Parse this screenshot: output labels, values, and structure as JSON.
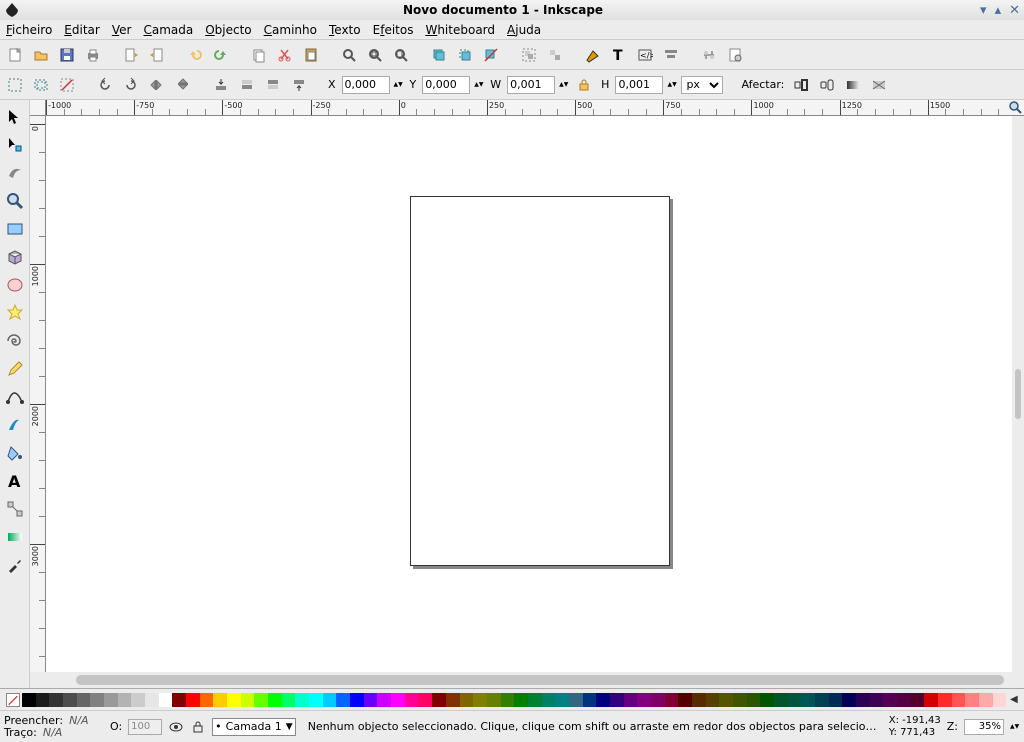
{
  "title": "Novo documento 1 - Inkscape",
  "menu": {
    "ficheiro": "Ficheiro",
    "editar": "Editar",
    "ver": "Ver",
    "camada": "Camada",
    "objecto": "Objecto",
    "caminho": "Caminho",
    "texto": "Texto",
    "efeitos": "Efeitos",
    "whiteboard": "Whiteboard",
    "ajuda": "Ajuda"
  },
  "toolbar2": {
    "x_label": "X",
    "x_value": "0,000",
    "y_label": "Y",
    "y_value": "0,000",
    "w_label": "W",
    "w_value": "0,001",
    "h_label": "H",
    "h_value": "0,001",
    "unit": "px",
    "affect_label": "Afectar:"
  },
  "ruler_h_ticks": [
    "-1000",
    "-750",
    "-500",
    "-250",
    "0",
    "250",
    "500",
    "750",
    "1000",
    "1250",
    "1500"
  ],
  "ruler_v_ticks": [
    "0",
    "1000",
    "2000",
    "3000"
  ],
  "palette": [
    "#000000",
    "#1a1a1a",
    "#333333",
    "#4d4d4d",
    "#666666",
    "#808080",
    "#999999",
    "#b3b3b3",
    "#cccccc",
    "#e6e6e6",
    "#ffffff",
    "#800000",
    "#ff0000",
    "#ff6600",
    "#ffcc00",
    "#ffff00",
    "#ccff00",
    "#66ff00",
    "#00ff00",
    "#00ff66",
    "#00ffcc",
    "#00ffff",
    "#00ccff",
    "#0066ff",
    "#0000ff",
    "#6600ff",
    "#cc00ff",
    "#ff00ff",
    "#ff0099",
    "#ff0066",
    "#800000",
    "#803300",
    "#806600",
    "#808000",
    "#668000",
    "#338000",
    "#008000",
    "#008033",
    "#008066",
    "#008080",
    "#336680",
    "#003380",
    "#000080",
    "#330080",
    "#660080",
    "#800080",
    "#800066",
    "#800033",
    "#550000",
    "#552b00",
    "#554000",
    "#555500",
    "#405500",
    "#2b5500",
    "#005500",
    "#00552b",
    "#005540",
    "#005555",
    "#004055",
    "#002b55",
    "#000055",
    "#2b0055",
    "#400055",
    "#550055",
    "#550040",
    "#55002b",
    "#d40000",
    "#ff2a2a",
    "#ff5555",
    "#ff8080",
    "#ffaaaa",
    "#ffd5d5"
  ],
  "status": {
    "fill_label": "Preencher:",
    "fill_value": "N/A",
    "stroke_label": "Traço:",
    "stroke_value": "N/A",
    "opacity_label": "O:",
    "opacity_value": "100",
    "layer_dot": "•",
    "layer_name": "Camada 1",
    "hint": "Nenhum objecto seleccionado. Clique, clique com shift ou arraste em redor dos objectos para selecionar.",
    "x_label": "X:",
    "x_value": "-191,43",
    "y_label": "Y:",
    "y_value": "771,43",
    "z_label": "Z:",
    "zoom": "35%"
  }
}
